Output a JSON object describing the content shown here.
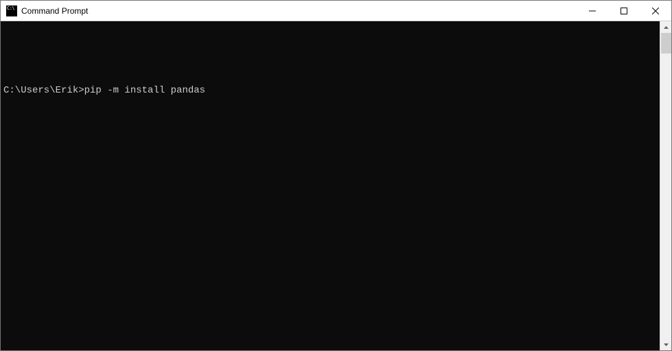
{
  "window": {
    "title": "Command Prompt"
  },
  "console": {
    "prompt": "C:\\Users\\Erik>",
    "command": "pip -m install pandas"
  }
}
